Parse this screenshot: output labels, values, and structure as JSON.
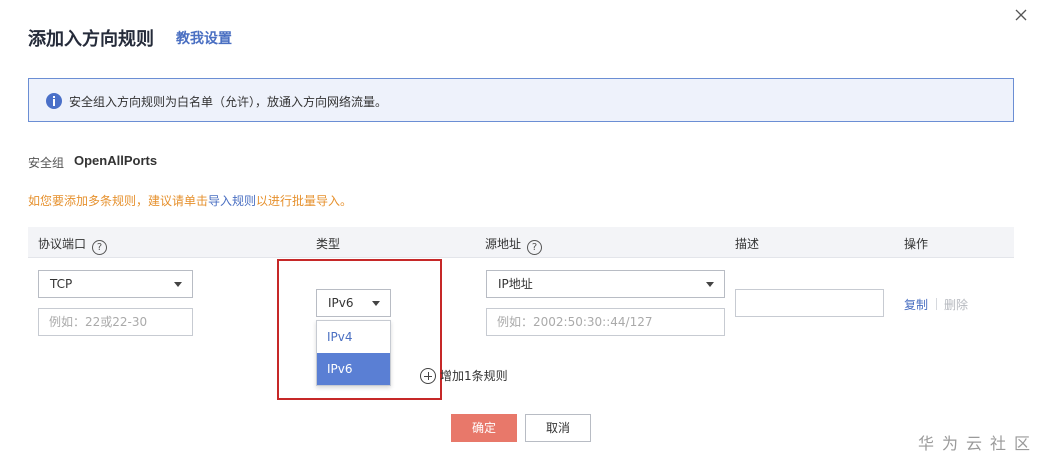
{
  "dialog": {
    "title": "添加入方向规则",
    "guide_link": "教我设置",
    "info_text": "安全组入方向规则为白名单（允许），放通入方向网络流量。",
    "sg_label": "安全组",
    "sg_name": "OpenAllPorts",
    "hint_prefix": "如您要添加多条规则，建议请单击",
    "hint_link": "导入规则",
    "hint_suffix": "以进行批量导入。"
  },
  "table": {
    "headers": {
      "protocol_port": "协议端口",
      "type": "类型",
      "source": "源地址",
      "description": "描述",
      "operation": "操作"
    },
    "row": {
      "protocol_value": "TCP",
      "port_placeholder": "例如：22或22-30",
      "type_value": "IPv6",
      "source_type_value": "IP地址",
      "source_placeholder": "例如：2002:50:30::44/127",
      "description_value": "",
      "copy_label": "复制",
      "delete_label": "删除"
    }
  },
  "type_dropdown": {
    "options": [
      "IPv4",
      "IPv6"
    ],
    "selected": "IPv6"
  },
  "add_rule_label": "增加1条规则",
  "buttons": {
    "ok": "确定",
    "cancel": "取消"
  },
  "watermark": "华为云社区",
  "colors": {
    "accent": "#4a6fc2",
    "ok_button": "#e8786a",
    "hint": "#e6912e",
    "highlight_frame": "#c62828",
    "dropdown_selected": "#5a7fd4"
  }
}
